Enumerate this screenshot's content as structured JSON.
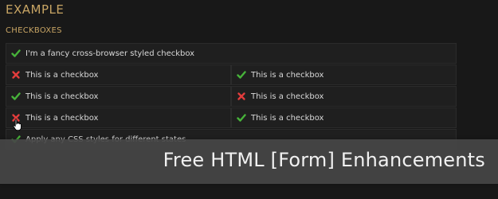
{
  "page": {
    "title": "EXAMPLE",
    "section": "CHECKBOXES"
  },
  "rows": [
    {
      "type": "full",
      "items": [
        {
          "label": "I'm a fancy cross-browser styled checkbox",
          "checked": true
        }
      ]
    },
    {
      "type": "half",
      "items": [
        {
          "label": "This is a checkbox",
          "checked": false
        },
        {
          "label": "This is a checkbox",
          "checked": true
        }
      ]
    },
    {
      "type": "half",
      "items": [
        {
          "label": "This is a checkbox",
          "checked": true
        },
        {
          "label": "This is a checkbox",
          "checked": false
        }
      ]
    },
    {
      "type": "half",
      "items": [
        {
          "label": "This is a checkbox",
          "checked": false
        },
        {
          "label": "This is a checkbox",
          "checked": true
        }
      ]
    },
    {
      "type": "full",
      "items": [
        {
          "label": "Apply any CSS styles for different states",
          "checked": true
        }
      ]
    }
  ],
  "banner": {
    "text": "Free HTML [Form] Enhancements"
  },
  "colors": {
    "accent_gold": "#c8a564",
    "check_green": "#47b33a",
    "cross_red": "#e23c3c",
    "background": "#181818"
  }
}
